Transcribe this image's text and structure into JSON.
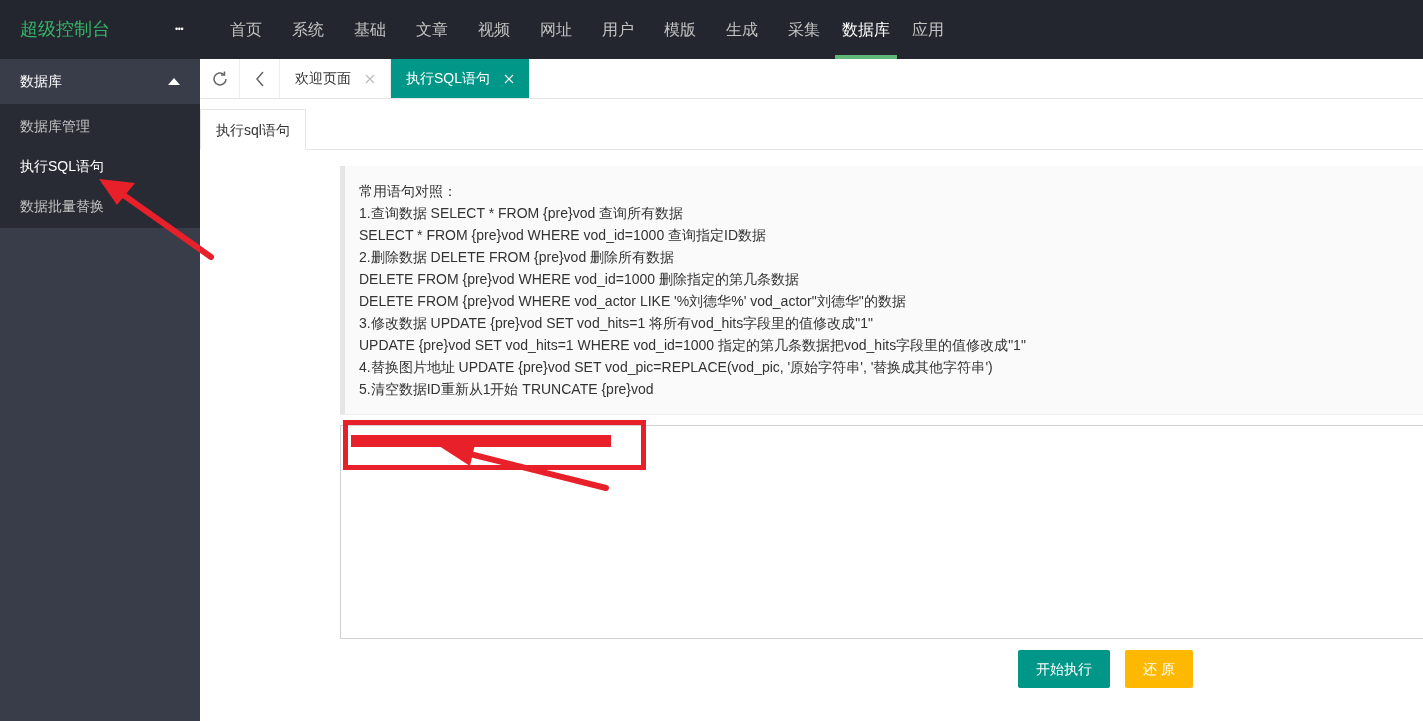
{
  "header": {
    "logo": "超级控制台",
    "more": "•••",
    "nav": [
      {
        "label": "首页",
        "selected": false
      },
      {
        "label": "系统",
        "selected": false
      },
      {
        "label": "基础",
        "selected": false
      },
      {
        "label": "文章",
        "selected": false
      },
      {
        "label": "视频",
        "selected": false
      },
      {
        "label": "网址",
        "selected": false
      },
      {
        "label": "用户",
        "selected": false
      },
      {
        "label": "模版",
        "selected": false
      },
      {
        "label": "生成",
        "selected": false
      },
      {
        "label": "采集",
        "selected": false
      },
      {
        "label": "数据库",
        "selected": true
      },
      {
        "label": "应用",
        "selected": false
      }
    ]
  },
  "sidebar": {
    "group": {
      "label": "数据库",
      "expanded": true
    },
    "items": [
      {
        "label": "数据库管理",
        "selected": false
      },
      {
        "label": "执行SQL语句",
        "selected": true
      },
      {
        "label": "数据批量替换",
        "selected": false
      }
    ]
  },
  "tabs": [
    {
      "label": "欢迎页面",
      "selected": false
    },
    {
      "label": "执行SQL语句",
      "selected": true
    }
  ],
  "panel_tabs": [
    {
      "label": "执行sql语句",
      "selected": true
    }
  ],
  "reference": [
    "常用语句对照：",
    "1.查询数据 SELECT * FROM {pre}vod 查询所有数据",
    "SELECT * FROM {pre}vod WHERE vod_id=1000 查询指定ID数据",
    "2.删除数据 DELETE FROM {pre}vod 删除所有数据",
    "DELETE FROM {pre}vod WHERE vod_id=1000 删除指定的第几条数据",
    "DELETE FROM {pre}vod WHERE vod_actor LIKE '%刘德华%' vod_actor\"刘德华\"的数据",
    "3.修改数据 UPDATE {pre}vod SET vod_hits=1 将所有vod_hits字段里的值修改成\"1\"",
    "UPDATE {pre}vod SET vod_hits=1 WHERE vod_id=1000 指定的第几条数据把vod_hits字段里的值修改成\"1\"",
    "4.替换图片地址 UPDATE {pre}vod SET vod_pic=REPLACE(vod_pic, '原始字符串', '替换成其他字符串')",
    "5.清空数据ID重新从1开始 TRUNCATE {pre}vod"
  ],
  "buttons": [
    {
      "label": "开始执行",
      "kind": "primary"
    },
    {
      "label": "还 原",
      "kind": "warning"
    }
  ]
}
